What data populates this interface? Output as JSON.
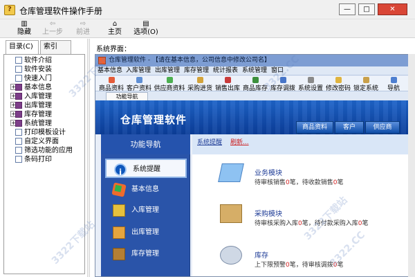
{
  "app": {
    "title": "仓库管理软件操作手册"
  },
  "window_controls": {
    "min": "—",
    "max": "□",
    "close": "✕"
  },
  "toolbar": {
    "hide": "隐藏",
    "back": "上一步",
    "forward": "前进",
    "home": "主页",
    "options": "选项",
    "options_key": "(O)"
  },
  "tabs": {
    "contents": "目录(C)",
    "index": "索引(N)"
  },
  "tree": [
    {
      "label": "软件介绍",
      "kind": "page",
      "expandable": false
    },
    {
      "label": "软件安装",
      "kind": "page",
      "expandable": false
    },
    {
      "label": "快速入门",
      "kind": "page",
      "expandable": false
    },
    {
      "label": "基本信息",
      "kind": "book",
      "expandable": true
    },
    {
      "label": "入库管理",
      "kind": "book",
      "expandable": true
    },
    {
      "label": "出库管理",
      "kind": "book",
      "expandable": true
    },
    {
      "label": "库存管理",
      "kind": "book",
      "expandable": true
    },
    {
      "label": "系统管理",
      "kind": "book",
      "expandable": true
    },
    {
      "label": "打印模板设计",
      "kind": "page",
      "expandable": false
    },
    {
      "label": "自定义界面",
      "kind": "page",
      "expandable": false
    },
    {
      "label": "筛选功能的应用",
      "kind": "page",
      "expandable": false
    },
    {
      "label": "条码打印",
      "kind": "page",
      "expandable": false
    }
  ],
  "content": {
    "section_label": "系统界面："
  },
  "inner_app": {
    "title": "仓库管理软件 - 【请在基本信息，公司信息中修改公司名】",
    "menu": [
      "基本信息",
      "入库管理",
      "出库管理",
      "库存管理",
      "统计报表",
      "系统管理",
      "窗口"
    ],
    "toolbar": [
      "商品资料",
      "客户资料",
      "供应商资料",
      "采购进货",
      "销售出库",
      "商品库存",
      "库存调拨",
      "系统设置",
      "修改密码",
      "锁定系统",
      "导航"
    ],
    "tab": "功能导航",
    "banner_title": "仓库管理软件",
    "banner_tabs": [
      "商品资料",
      "客户",
      "供应商"
    ],
    "nav_header": "功能导航",
    "nav_items": [
      "系统提醒",
      "基本信息",
      "入库管理",
      "出库管理",
      "库存管理"
    ],
    "panel_tabs": [
      "系统提醒",
      "刷新..."
    ],
    "modules": [
      {
        "title": "业务模块",
        "prefix_a": "待审核销售",
        "value_a": "0",
        "unit_a": "笔，",
        "prefix_b": "待收款销售",
        "value_b": "0",
        "unit_b": "笔"
      },
      {
        "title": "采购模块",
        "prefix_a": "待审核采购入库",
        "value_a": "0",
        "unit_a": "笔，",
        "prefix_b": "待付款采购入库",
        "value_b": "0",
        "unit_b": "笔"
      },
      {
        "title": "库存",
        "prefix_a": "上下限预警",
        "value_a": "0",
        "unit_a": "笔，",
        "prefix_b": "待审核调拨",
        "value_b": "0",
        "unit_b": "笔"
      }
    ]
  },
  "watermark": {
    "text": "3322下载站",
    "domain": "3322.CC"
  }
}
